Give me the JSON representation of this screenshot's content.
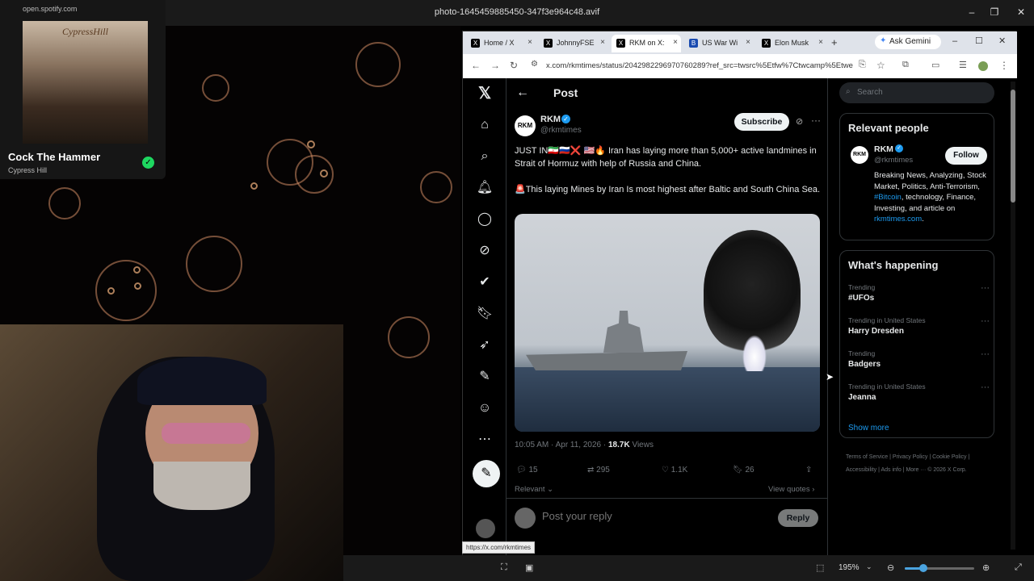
{
  "viewer": {
    "title": "photo-1645459885450-347f3e964c48.avif",
    "zoom": "195%",
    "zoom_level": 0.27,
    "status_link": "https://x.com/rkmtimes"
  },
  "spotify": {
    "url": "open.spotify.com",
    "album_art_text": "CypressHill",
    "song": "Cock The Hammer",
    "artist": "Cypress Hill",
    "check_icon": "check-circle-icon"
  },
  "browser": {
    "tabs": [
      {
        "label": "Home / X",
        "active": false
      },
      {
        "label": "JohnnyFSE",
        "active": false
      },
      {
        "label": "RKM on X:",
        "active": true
      },
      {
        "label": "US War Wi",
        "active": false
      },
      {
        "label": "Elon Musk",
        "active": false
      }
    ],
    "ask_gemini": "Ask Gemini",
    "url": "x.com/rkmtimes/status/2042982296970760289?ref_src=twsrc%5Etfw%7Ctwcamp%5Etwee..."
  },
  "post": {
    "header_title": "Post",
    "author_name": "RKM",
    "author_handle": "@rkmtimes",
    "avatar_text": "RKM",
    "subscribe_label": "Subscribe",
    "text_line1": "JUST IN🇮🇷🇷🇺❌ 🇺🇸🔥 Iran has laying more than 5,000+ active landmines in Strait of Hormuz with help of Russia and China.",
    "text_line2": "🚨This laying Mines by Iran Is most highest after Baltic and South China Sea.",
    "timestamp": "10:05 AM · Apr 11, 2026 · ",
    "views_count": "18.7K",
    "views_label": " Views",
    "replies": "15",
    "reposts": "295",
    "likes": "1.1K",
    "bookmarks": "26",
    "relevant_label": "Relevant",
    "view_quotes_label": "View quotes",
    "reply_placeholder": "Post your reply",
    "reply_button": "Reply"
  },
  "sidebar": {
    "search_placeholder": "Search",
    "relevant_people_title": "Relevant people",
    "rp_name": "RKM",
    "rp_handle": "@rkmtimes",
    "rp_follow": "Follow",
    "rp_bio_text": "Breaking News, Analyzing, Stock Market, Politics, Anti-Terrorism, ",
    "rp_bio_tag": "#Bitcoin",
    "rp_bio_text2": ", technology, Finance, Investing, and article on ",
    "rp_bio_link": "rkmtimes.com",
    "rp_bio_end": ".",
    "happening_title": "What's happening",
    "trends": [
      {
        "context": "Trending",
        "topic": "#UFOs"
      },
      {
        "context": "Trending in United States",
        "topic": "Harry Dresden"
      },
      {
        "context": "Trending",
        "topic": "Badgers"
      },
      {
        "context": "Trending in United States",
        "topic": "Jeanna"
      }
    ],
    "show_more": "Show more",
    "footer": "Terms of Service  |  Privacy Policy  |  Cookie Policy  |  Accessibility  |  Ads info  |  More ···  © 2026 X Corp."
  },
  "colors": {
    "accent": "#1d9bf0",
    "spotify_green": "#1ed760",
    "x_background": "#000000"
  }
}
